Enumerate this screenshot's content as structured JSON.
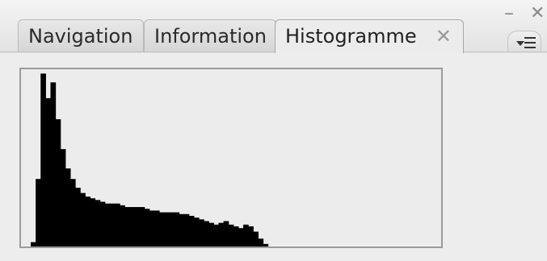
{
  "tabs": [
    {
      "label": "Navigation",
      "active": false
    },
    {
      "label": "Information",
      "active": false
    },
    {
      "label": "Histogramme",
      "active": true
    }
  ],
  "icons": {
    "tab_close": "close-icon",
    "minimize": "minimize-icon",
    "window_close": "close-icon",
    "panel_menu": "panel-menu-icon"
  },
  "symbols": {
    "tab_close": "✕",
    "minimize": "–",
    "window_close": "✕"
  },
  "colors": {
    "histogram_fill": "#000000",
    "panel_bg": "#ededed"
  },
  "chart_data": {
    "type": "area",
    "x": [
      0,
      4,
      8,
      12,
      16,
      20,
      24,
      28,
      32,
      36,
      40,
      44,
      48,
      52,
      56,
      60,
      64,
      68,
      72,
      76,
      80,
      84,
      88,
      92,
      96,
      100,
      104,
      108,
      112,
      116,
      120,
      124,
      128,
      132,
      136,
      140,
      144,
      148,
      152,
      156,
      160,
      164,
      168,
      172,
      176,
      180,
      184,
      188,
      192,
      196,
      200,
      204,
      208,
      212,
      216,
      220,
      224,
      228,
      232,
      236,
      240,
      244,
      248,
      252,
      255
    ],
    "values": [
      2,
      38,
      98,
      84,
      93,
      72,
      55,
      44,
      38,
      33,
      30,
      28,
      27,
      26,
      25,
      24,
      24,
      24,
      23,
      22,
      22,
      22,
      22,
      21,
      20,
      20,
      19,
      19,
      19,
      19,
      18,
      18,
      17,
      16,
      15,
      14,
      13,
      12,
      13,
      14,
      12,
      11,
      10,
      12,
      11,
      8,
      4,
      1,
      0,
      0,
      0,
      0,
      0,
      0,
      0,
      0,
      0,
      0,
      0,
      0,
      0,
      0,
      0,
      0,
      0
    ],
    "xlim": [
      0,
      255
    ],
    "ylim": [
      0,
      100
    ]
  }
}
